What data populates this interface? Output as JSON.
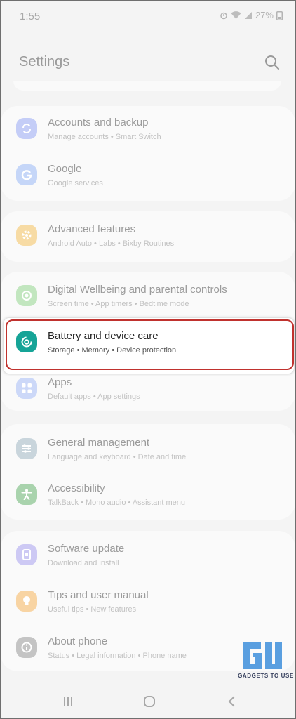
{
  "status_bar": {
    "time": "1:55",
    "battery": "27%"
  },
  "header": {
    "title": "Settings"
  },
  "settings": [
    {
      "title": "Accounts and backup",
      "subtitle": "Manage accounts • Smart Switch",
      "icon": "sync-icon",
      "color": "#7a8ff0"
    },
    {
      "title": "Google",
      "subtitle": "Google services",
      "icon": "google-icon",
      "color": "#7ea4f3"
    },
    {
      "title": "Advanced features",
      "subtitle": "Android Auto • Labs • Bixby Routines",
      "icon": "gear-plus-icon",
      "color": "#f2b84b"
    },
    {
      "title": "Digital Wellbeing and parental controls",
      "subtitle": "Screen time • App timers • Bedtime mode",
      "icon": "wellbeing-icon",
      "color": "#74c66f"
    },
    {
      "title": "Battery and device care",
      "subtitle": "Storage  •  Memory  •  Device protection",
      "icon": "device-care-icon",
      "color": "#16a497"
    },
    {
      "title": "Apps",
      "subtitle": "Default apps • App settings",
      "icon": "apps-grid-icon",
      "color": "#8fa7f0"
    },
    {
      "title": "General management",
      "subtitle": "Language and keyboard • Date and time",
      "icon": "sliders-icon",
      "color": "#8fa8b8"
    },
    {
      "title": "Accessibility",
      "subtitle": "TalkBack • Mono audio • Assistant menu",
      "icon": "accessibility-icon",
      "color": "#5aa863"
    },
    {
      "title": "Software update",
      "subtitle": "Download and install",
      "icon": "software-update-icon",
      "color": "#8f86e6"
    },
    {
      "title": "Tips and user manual",
      "subtitle": "Useful tips • New features",
      "icon": "lightbulb-icon",
      "color": "#f4b25b"
    },
    {
      "title": "About phone",
      "subtitle": "Status • Legal information • Phone name",
      "icon": "info-icon",
      "color": "#8d8d8d"
    }
  ],
  "watermark": {
    "text": "GADGETS TO USE",
    "color": "#5a9fe0"
  }
}
